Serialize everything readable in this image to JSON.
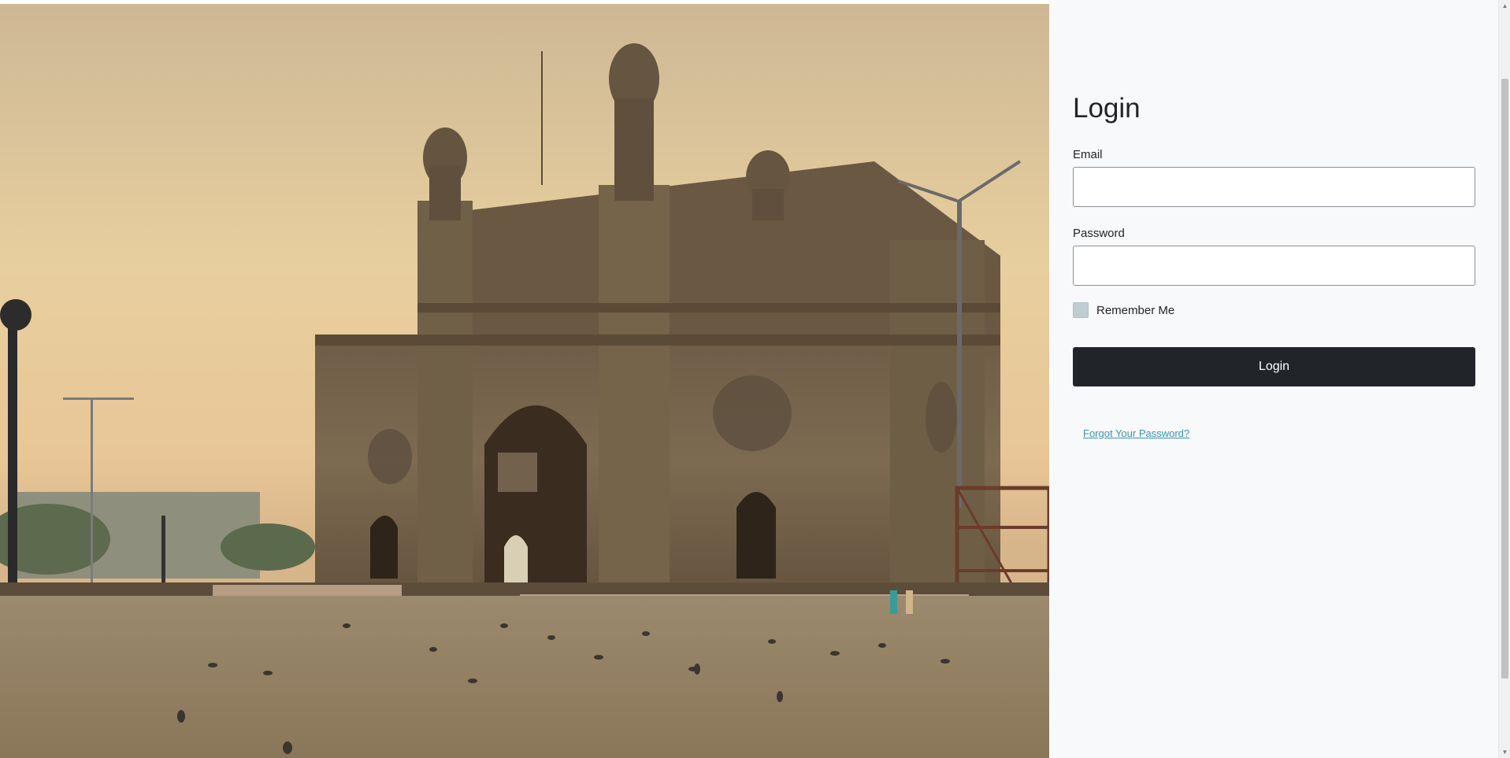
{
  "login": {
    "title": "Login",
    "email_label": "Email",
    "email_value": "",
    "password_label": "Password",
    "password_value": "",
    "remember_label": "Remember Me",
    "remember_checked": false,
    "submit_label": "Login",
    "forgot_label": "Forgot Your Password?"
  },
  "hero": {
    "description_icon": "gateway-of-india-photo-icon"
  },
  "colors": {
    "button_bg": "#212529",
    "link": "#3a93b0",
    "panel_bg": "#f8f9fa"
  }
}
